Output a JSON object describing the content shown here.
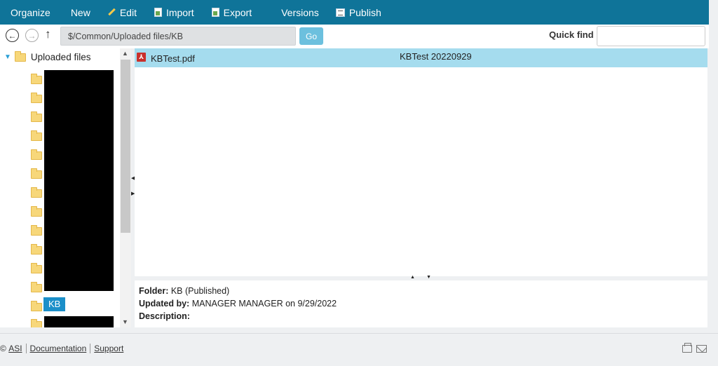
{
  "toolbar": {
    "organize": "Organize",
    "new": "New",
    "edit": "Edit",
    "import": "Import",
    "export": "Export",
    "versions": "Versions",
    "publish": "Publish"
  },
  "address": {
    "path": "$/Common/Uploaded files/KB",
    "go": "Go",
    "quick_find_label": "Quick find",
    "quick_find_value": ""
  },
  "tree": {
    "root": "Uploaded files",
    "selected": "KB"
  },
  "files": [
    {
      "name": "KBTest.pdf",
      "title": "KBTest 20220929",
      "icon": "pdf-icon"
    }
  ],
  "details": {
    "folder_label": "Folder:",
    "folder_value": "KB (Published)",
    "updated_label": "Updated by:",
    "updated_value": "MANAGER MANAGER on 9/29/2022",
    "description_label": "Description:",
    "description_value": ""
  },
  "footer": {
    "copyright": "©",
    "asi": "ASI",
    "documentation": "Documentation",
    "support": "Support"
  },
  "colors": {
    "toolbar_bg": "#0f7499",
    "selected_row": "#a5dcee",
    "go_button": "#6cc0de",
    "tree_selected": "#1b8fc9"
  }
}
